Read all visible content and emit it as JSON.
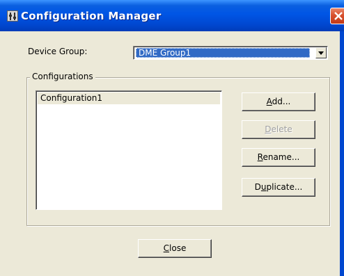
{
  "window": {
    "title": "Configuration Manager",
    "icon": "dme-fader-icon",
    "title_bar_color": "#0055e5",
    "face_color": "#ece9d8"
  },
  "device_group": {
    "label": "Device Group:",
    "selected": "DME Group1"
  },
  "configurations": {
    "group_label": "Configurations",
    "items": [
      "Configuration1"
    ]
  },
  "buttons": {
    "add": {
      "label_mn": "A",
      "label_rest": "dd..."
    },
    "delete": {
      "label_mn": "D",
      "label_rest": "elete",
      "enabled": false
    },
    "rename": {
      "label_mn": "R",
      "label_rest": "ename..."
    },
    "duplicate": {
      "label_pre": "D",
      "label_mn": "u",
      "label_rest": "plicate..."
    },
    "close": {
      "label_mn": "C",
      "label_rest": "lose"
    }
  }
}
